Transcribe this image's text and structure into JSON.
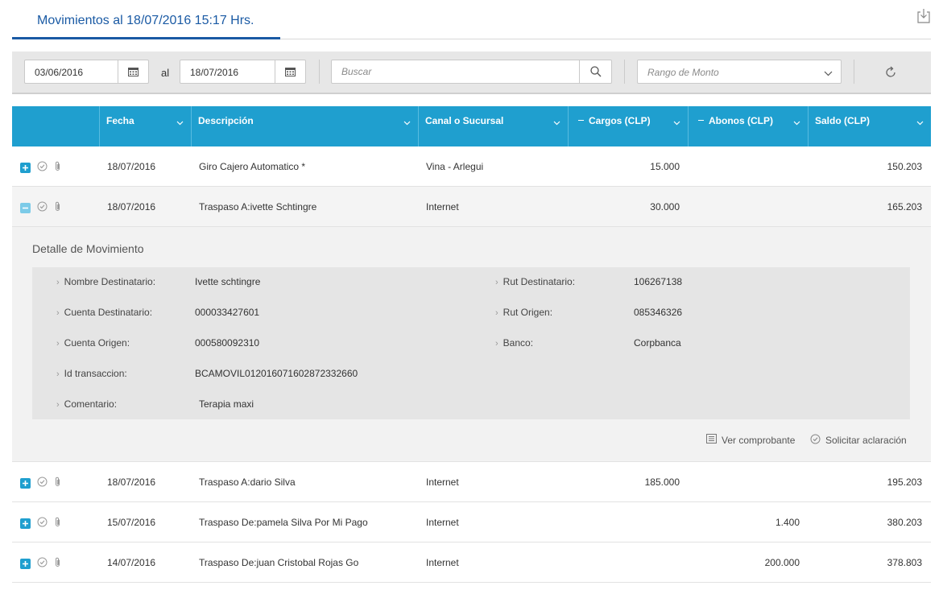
{
  "header": {
    "title": "Movimientos al 18/07/2016 15:17 Hrs."
  },
  "filters": {
    "date_from": "03/06/2016",
    "al_label": "al",
    "date_to": "18/07/2016",
    "search_placeholder": "Buscar",
    "monto_placeholder": "Rango de Monto"
  },
  "table": {
    "columns": [
      "Fecha",
      "Descripción",
      "Canal o Sucursal",
      "Cargos (CLP)",
      "Abonos (CLP)",
      "Saldo (CLP)"
    ],
    "rows": [
      {
        "fecha": "18/07/2016",
        "descripcion": "Giro Cajero Automatico *",
        "canal": "Vina - Arlegui",
        "cargos": "15.000",
        "abonos": "",
        "saldo": "150.203"
      },
      {
        "fecha": "18/07/2016",
        "descripcion": "Traspaso A:ivette Schtingre",
        "canal": "Internet",
        "cargos": "30.000",
        "abonos": "",
        "saldo": "165.203"
      },
      {
        "fecha": "18/07/2016",
        "descripcion": "Traspaso A:dario Silva",
        "canal": "Internet",
        "cargos": "185.000",
        "abonos": "",
        "saldo": "195.203"
      },
      {
        "fecha": "15/07/2016",
        "descripcion": "Traspaso De:pamela Silva Por Mi Pago",
        "canal": "Internet",
        "cargos": "",
        "abonos": "1.400",
        "saldo": "380.203"
      },
      {
        "fecha": "14/07/2016",
        "descripcion": "Traspaso De:juan Cristobal Rojas Go",
        "canal": "Internet",
        "cargos": "",
        "abonos": "200.000",
        "saldo": "378.803"
      }
    ]
  },
  "detail": {
    "title": "Detalle de Movimiento",
    "fields": {
      "nombre_destinatario": {
        "label": "Nombre Destinatario:",
        "value": "Ivette schtingre"
      },
      "cuenta_destinatario": {
        "label": "Cuenta Destinatario:",
        "value": "000033427601"
      },
      "cuenta_origen": {
        "label": "Cuenta Origen:",
        "value": "000580092310"
      },
      "id_transaccion": {
        "label": "Id transaccion:",
        "value": "BCAMOVIL012016071602872332660"
      },
      "comentario": {
        "label": "Comentario:",
        "value": "Terapia maxi"
      },
      "rut_destinatario": {
        "label": "Rut Destinatario:",
        "value": "106267138"
      },
      "rut_origen": {
        "label": "Rut Origen:",
        "value": "085346326"
      },
      "banco": {
        "label": "Banco:",
        "value": "Corpbanca"
      }
    },
    "ver_comprobante": "Ver comprobante",
    "solicitar_aclaracion": "Solicitar aclaración"
  },
  "colors": {
    "accent": "#1a5aa4",
    "header_bg": "#1f9fcf"
  }
}
